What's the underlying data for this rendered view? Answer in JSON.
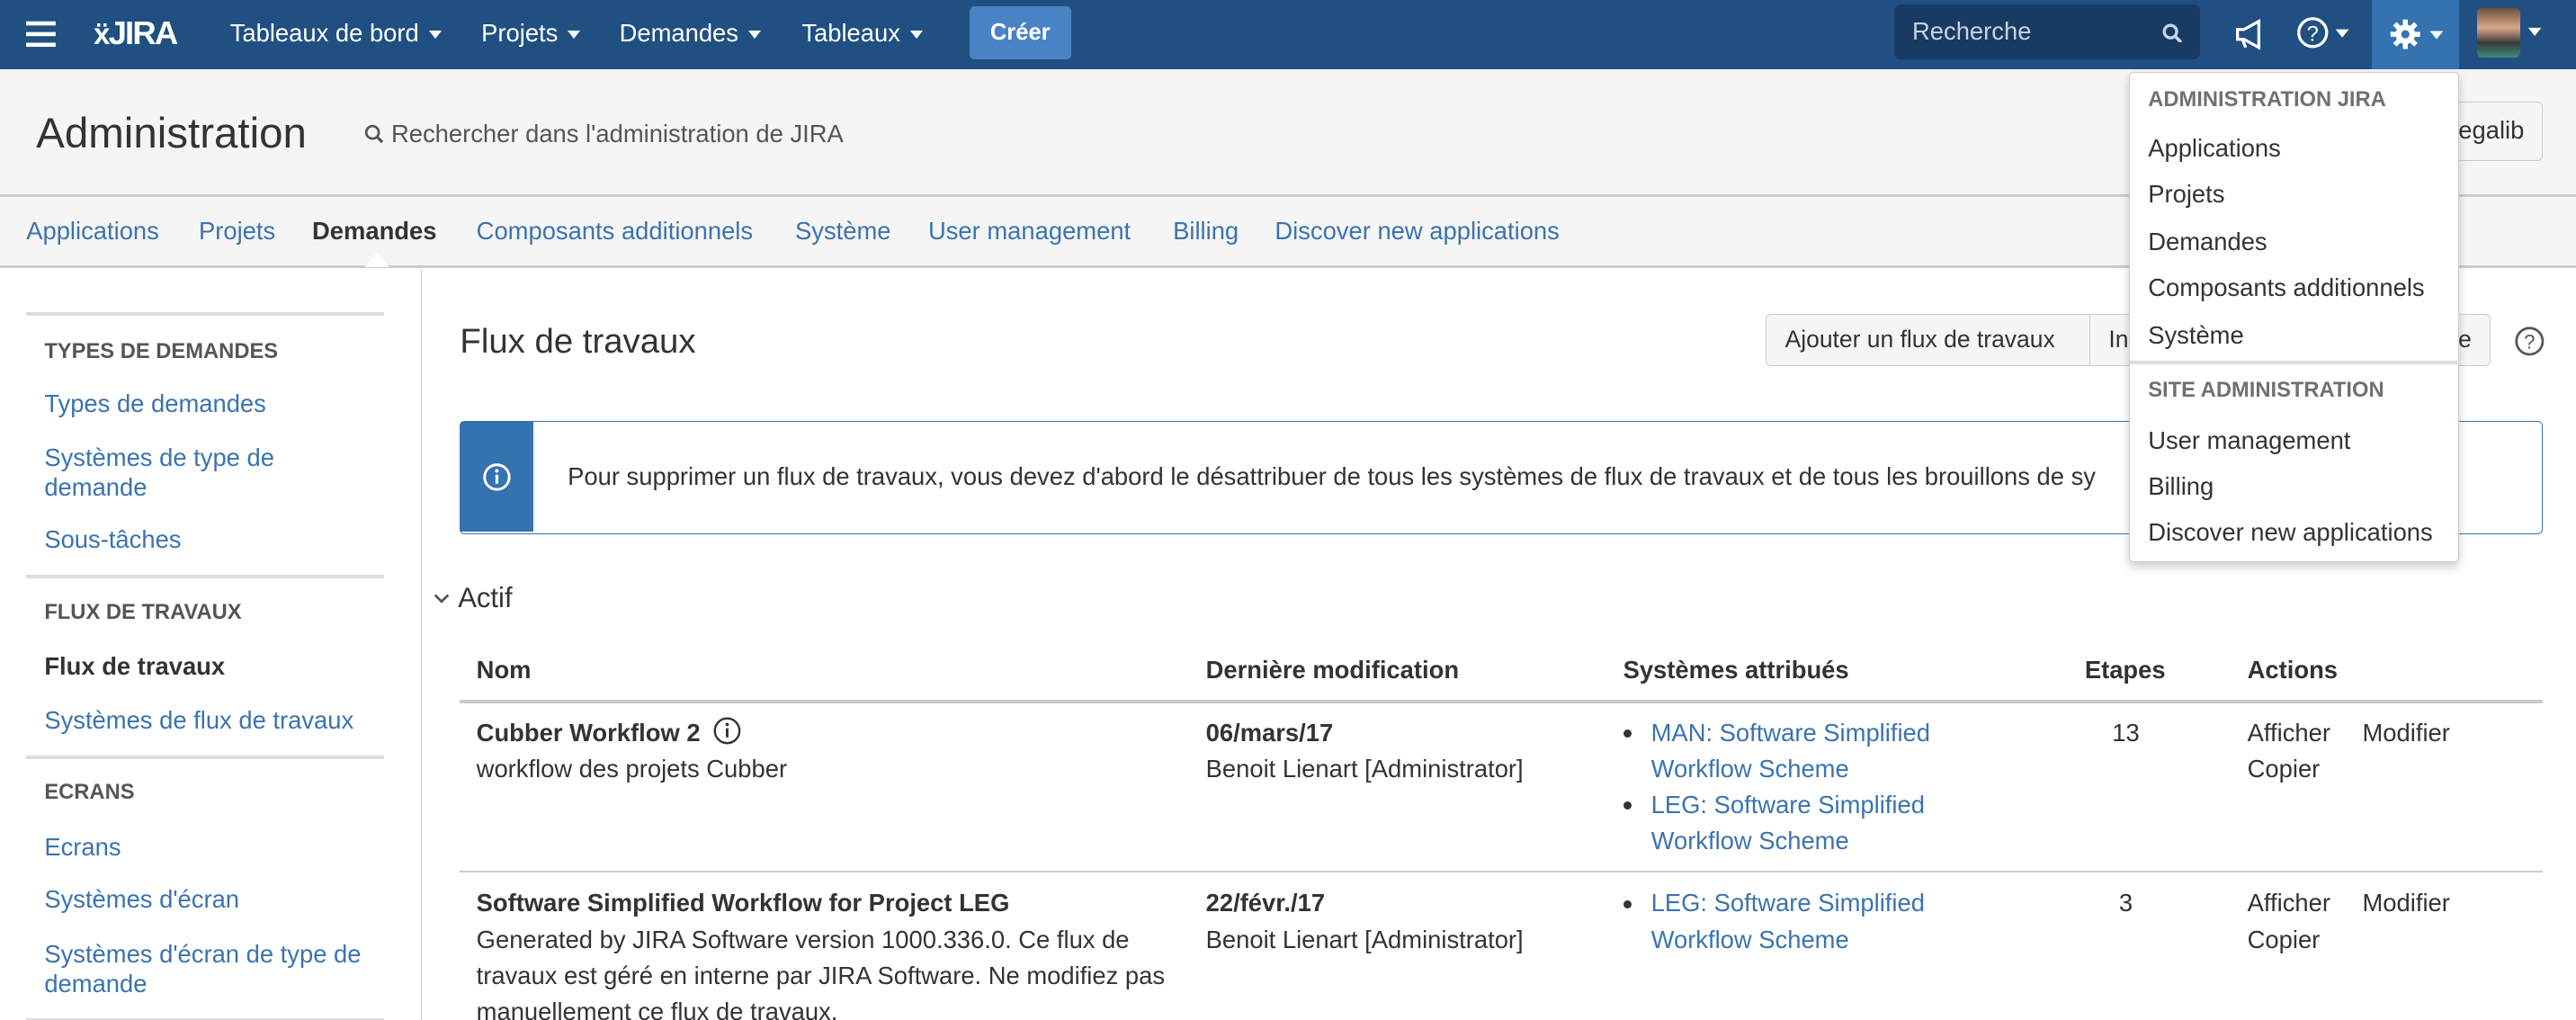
{
  "topnav": {
    "logo": "JIRA",
    "menus": [
      "Tableaux de bord",
      "Projets",
      "Demandes",
      "Tableaux"
    ],
    "create": "Créer",
    "search_placeholder": "Recherche"
  },
  "header": {
    "title": "Administration",
    "search": "Rechercher dans l'administration de JIRA",
    "user_button": "egalib"
  },
  "tabs": [
    {
      "label": "Applications"
    },
    {
      "label": "Projets"
    },
    {
      "label": "Demandes",
      "active": true
    },
    {
      "label": "Composants additionnels"
    },
    {
      "label": "Système"
    },
    {
      "label": "User management"
    },
    {
      "label": "Billing"
    },
    {
      "label": "Discover new applications"
    }
  ],
  "sidebar": {
    "sections": [
      {
        "title": "TYPES DE DEMANDES",
        "items": [
          "Types de demandes",
          "Systèmes de type de demande",
          "Sous-tâches"
        ]
      },
      {
        "title": "FLUX DE TRAVAUX",
        "items": [
          "Flux de travaux",
          "Systèmes de flux de travaux"
        ],
        "active": "Flux de travaux"
      },
      {
        "title": "ECRANS",
        "items": [
          "Ecrans",
          "Systèmes d'écran",
          "Systèmes d'écran de type de demande"
        ]
      }
    ]
  },
  "main": {
    "title": "Flux de travaux",
    "buttons": [
      "Ajouter un flux de travaux",
      "In",
      "e"
    ],
    "info": "Pour supprimer un flux de travaux, vous devez d'abord le désattribuer de tous les systèmes de flux de travaux et de tous les brouillons de sy",
    "section": "Actif",
    "columns": [
      "Nom",
      "Dernière modification",
      "Systèmes attribués",
      "Etapes",
      "Actions"
    ],
    "rows": [
      {
        "name": "Cubber Workflow 2",
        "desc": "workflow des projets Cubber",
        "date": "06/mars/17",
        "author": "Benoit Lienart [Administrator]",
        "schemes": [
          "MAN: Software Simplified Workflow Scheme",
          "LEG: Software Simplified Workflow Scheme"
        ],
        "steps": "13",
        "actions": [
          "Afficher",
          "Modifier",
          "Copier"
        ]
      },
      {
        "name": "Software Simplified Workflow for Project LEG",
        "desc": "Generated by JIRA Software version 1000.336.0. Ce flux de travaux est géré en interne par JIRA Software. Ne modifiez pas manuellement ce flux de travaux.",
        "date": "22/févr./17",
        "author": "Benoit Lienart [Administrator]",
        "schemes": [
          "LEG: Software Simplified Workflow Scheme"
        ],
        "steps": "3",
        "actions": [
          "Afficher",
          "Modifier",
          "Copier"
        ]
      }
    ]
  },
  "dropdown": {
    "sections": [
      {
        "title": "ADMINISTRATION JIRA",
        "items": [
          "Applications",
          "Projets",
          "Demandes",
          "Composants additionnels",
          "Système"
        ]
      },
      {
        "title": "SITE ADMINISTRATION",
        "items": [
          "User management",
          "Billing",
          "Discover new applications"
        ]
      }
    ]
  },
  "colors": {
    "nav": "#205081",
    "accent": "#3572b0",
    "link": "#3b73af"
  }
}
